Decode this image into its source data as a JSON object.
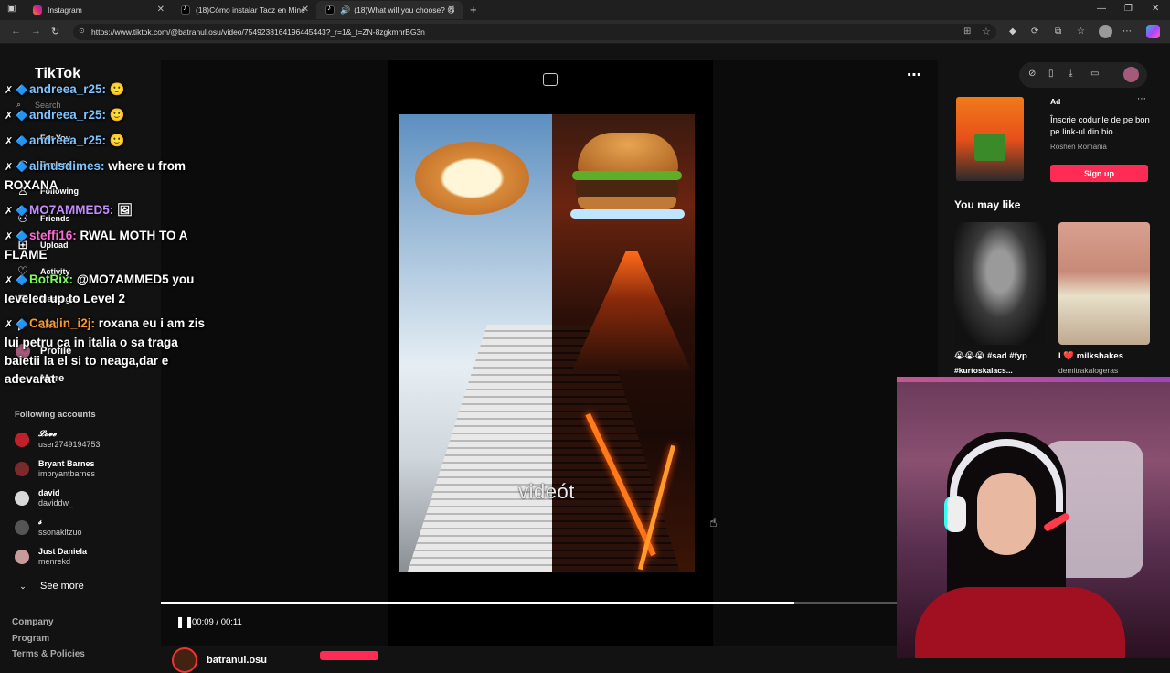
{
  "browser": {
    "tabs": [
      {
        "title": "Instagram",
        "icon": "instagram-icon"
      },
      {
        "title": "(18)Cómo instalar Tacz en Minecr",
        "icon": "tiktok-icon"
      },
      {
        "title": "(18)What will you choose? 😋",
        "icon": "tiktok-icon"
      }
    ],
    "url": "https://www.tiktok.com/@batranul.osu/video/7549238164196445443?_r=1&_t=ZN-8zgkmnrBG3n"
  },
  "sidebar": {
    "logo": "TikTok",
    "search_placeholder": "Search",
    "nav": [
      {
        "label": "For You",
        "icon": "home-icon"
      },
      {
        "label": "Explore",
        "icon": "compass-icon"
      },
      {
        "label": "Following",
        "icon": "following-icon"
      },
      {
        "label": "Friends",
        "icon": "friends-icon"
      },
      {
        "label": "Upload",
        "icon": "upload-icon"
      },
      {
        "label": "Activity",
        "icon": "activity-icon"
      },
      {
        "label": "Messages",
        "icon": "messages-icon"
      },
      {
        "label": "LIVE",
        "icon": "live-icon"
      },
      {
        "label": "Profile",
        "icon": "profile-icon"
      },
      {
        "label": "More",
        "icon": "more-icon"
      }
    ],
    "following_header": "Following accounts",
    "accounts": [
      {
        "name": "𝓛𝓸𝓿𝓮",
        "username": "user2749194753",
        "color": "#c0202a"
      },
      {
        "name": "Bryant Barnes",
        "username": "imbryantbarnes",
        "color": "#7a2a2a"
      },
      {
        "name": "david",
        "username": "daviddw_",
        "color": "#d8d8d8"
      },
      {
        "name": "𝓼",
        "username": "ssonakltzuo",
        "color": "#555555"
      },
      {
        "name": "Just Daniela",
        "username": "menrekd",
        "color": "#c89a9a"
      }
    ],
    "see_more": "See more",
    "footer": [
      "Company",
      "Program",
      "Terms & Policies"
    ]
  },
  "chat": [
    {
      "user": "andreea_r25:",
      "text": "🙂",
      "color": "#7fc4ff"
    },
    {
      "user": "andreea_r25:",
      "text": "🙂",
      "color": "#7fc4ff"
    },
    {
      "user": "andreea_r25:",
      "text": "🙂",
      "color": "#7fc4ff"
    },
    {
      "user": "alinusdimes:",
      "text": "where u from ROXANA",
      "color": "#7fc4ff"
    },
    {
      "user": "MO7AMMED5:",
      "text": "🖼",
      "color": "#c58cff"
    },
    {
      "user": "steffi16:",
      "text": "RWAL MOTH TO A FLAME",
      "color": "#ff6bd6"
    },
    {
      "user": "BotRix:",
      "text": "@MO7AMMED5 you leveled up to Level 2",
      "color": "#7dff5a"
    },
    {
      "user": "Catalin_i2j:",
      "text": "roxana eu i am zis lui petru ca in italia o sa traga baietii la el si to neaga,dar e adevarat",
      "color": "#ff9a2a"
    }
  ],
  "video": {
    "caption": "videót",
    "time_current": "00:09",
    "time_total": "00:11",
    "progress": 0.86,
    "author": "batranul.osu"
  },
  "ad": {
    "label": "Ad",
    "text": "Înscrie codurile de pe bon pe link-ul din bio ...",
    "brand": "Roshen Romania",
    "cta": "Sign up"
  },
  "recommend": {
    "header": "You may like",
    "items": [
      {
        "caption": "😭😭😭 #sad #fyp",
        "sub": "#kurtoskalacs..."
      },
      {
        "caption": "I ❤️ milkshakes",
        "sub": "demitrakalogeras"
      }
    ]
  }
}
